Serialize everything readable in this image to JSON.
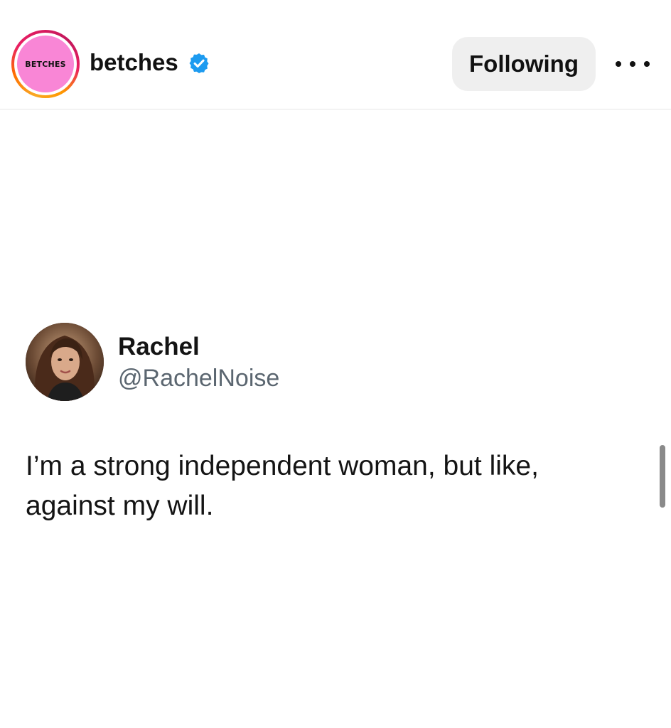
{
  "header": {
    "avatar_logo_text": "BETCHES",
    "account_name": "betches",
    "verified": true,
    "follow_button_label": "Following",
    "more_icon": "more-horizontal-icon"
  },
  "tweet": {
    "author_name": "Rachel",
    "author_handle": "@RachelNoise",
    "text": "I’m a strong independent woman, but like,\nagainst my will."
  },
  "colors": {
    "logo_pink": "#f986d6",
    "verified_blue": "#1d9bf0",
    "button_bg": "#efefef",
    "handle_gray": "#5b6670"
  }
}
